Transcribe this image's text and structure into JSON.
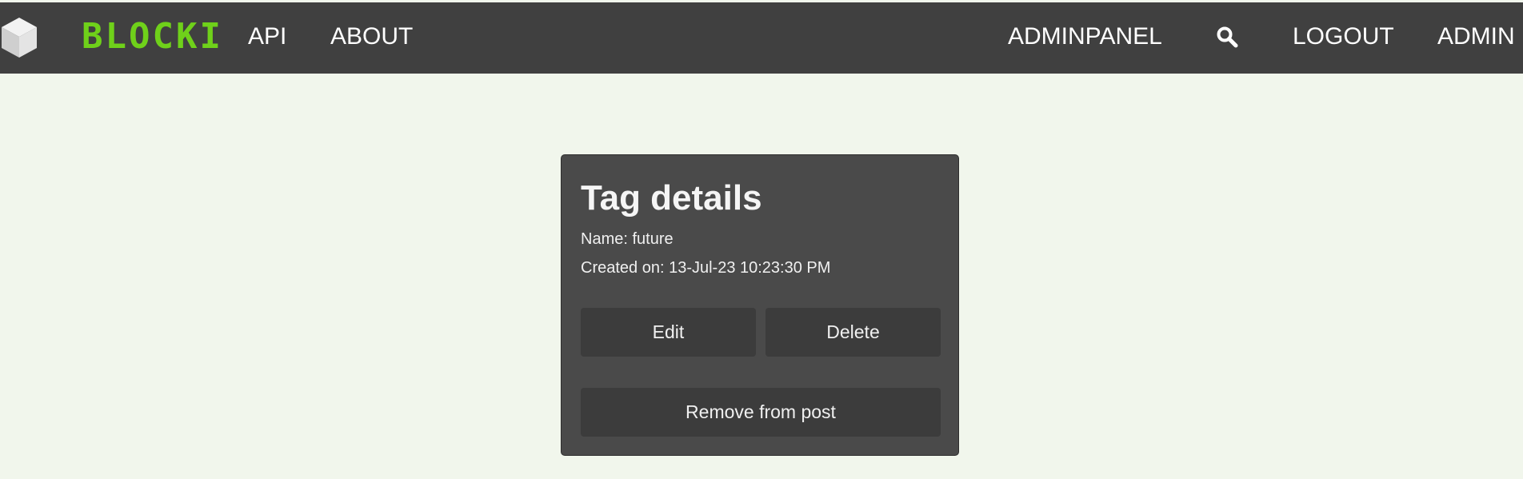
{
  "header": {
    "brand": "BLOCKI",
    "logo_icon": "cube-icon",
    "nav_left": [
      {
        "label": "API"
      },
      {
        "label": "ABOUT"
      }
    ],
    "nav_right": [
      {
        "label": "ADMINPANEL"
      },
      {
        "label": "LOGOUT"
      },
      {
        "label": "ADMIN"
      }
    ],
    "search_icon": "search-icon"
  },
  "card": {
    "title": "Tag details",
    "name_line": "Name: future",
    "created_line": "Created on: 13-Jul-23 10:23:30 PM",
    "buttons": {
      "edit": "Edit",
      "delete": "Delete",
      "remove": "Remove from post"
    }
  },
  "colors": {
    "page_background": "#f1f6ec",
    "topbar": "#404040",
    "brand": "#6fd11a",
    "card": "#4a4a4a",
    "button": "#3c3c3c"
  }
}
